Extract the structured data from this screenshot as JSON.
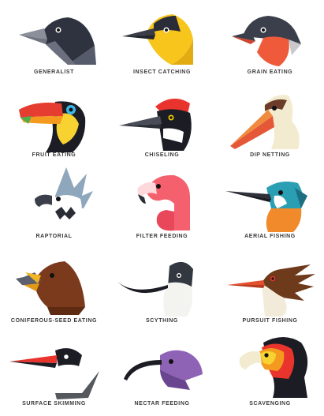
{
  "birds": [
    {
      "label": "GENERALIST"
    },
    {
      "label": "INSECT CATCHING"
    },
    {
      "label": "GRAIN EATING"
    },
    {
      "label": "FRUIT EATING"
    },
    {
      "label": "CHISELING"
    },
    {
      "label": "DIP NETTING"
    },
    {
      "label": "RAPTORIAL"
    },
    {
      "label": "FILTER FEEDING"
    },
    {
      "label": "AERIAL FISHING"
    },
    {
      "label": "CONIFEROUS-SEED EATING"
    },
    {
      "label": "SCYTHING"
    },
    {
      "label": "PURSUIT FISHING"
    },
    {
      "label": "SURFACE SKIMMING"
    },
    {
      "label": "NECTAR FEEDING"
    },
    {
      "label": "SCAVENGING"
    }
  ]
}
